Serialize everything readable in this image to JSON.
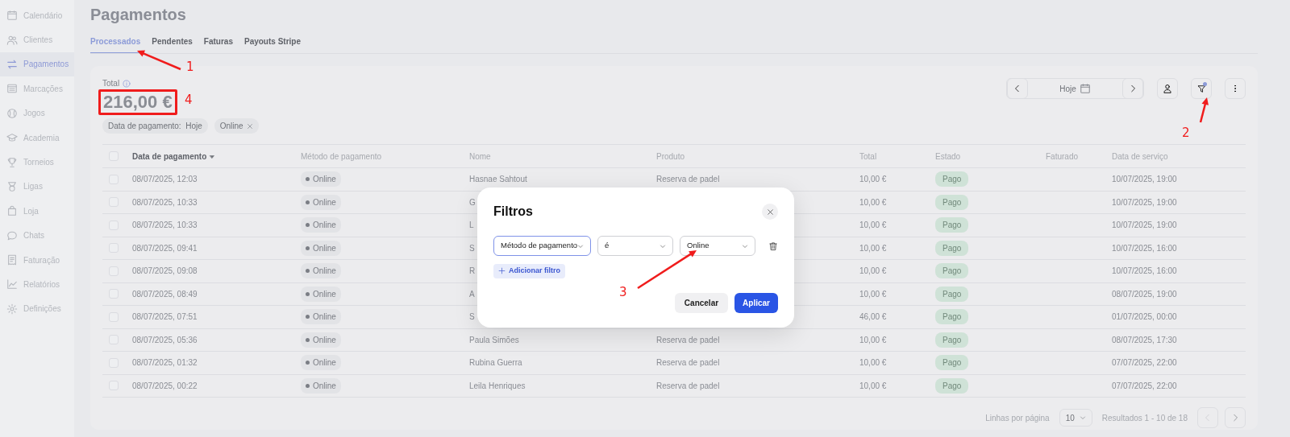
{
  "sidebar": {
    "items": [
      {
        "label": "Calendário",
        "selected": false
      },
      {
        "label": "Clientes",
        "selected": false
      },
      {
        "label": "Pagamentos",
        "selected": true
      },
      {
        "label": "Marcações",
        "selected": false
      },
      {
        "label": "Jogos",
        "selected": false
      },
      {
        "label": "Academia",
        "selected": false
      },
      {
        "label": "Torneios",
        "selected": false
      },
      {
        "label": "Ligas",
        "selected": false
      },
      {
        "label": "Loja",
        "selected": false
      },
      {
        "label": "Chats",
        "selected": false
      },
      {
        "label": "Faturação",
        "selected": false
      },
      {
        "label": "Relatórios",
        "selected": false
      },
      {
        "label": "Definições",
        "selected": false
      }
    ]
  },
  "page": {
    "title": "Pagamentos"
  },
  "tabs": [
    {
      "label": "Processados",
      "selected": true
    },
    {
      "label": "Pendentes",
      "selected": false
    },
    {
      "label": "Faturas",
      "selected": false
    },
    {
      "label": "Payouts Stripe",
      "selected": false
    }
  ],
  "summary": {
    "label": "Total",
    "amount": "216,00 €"
  },
  "toolbar": {
    "date_label": "Hoje",
    "filter_active": true
  },
  "filter_chips": [
    {
      "label": "Data de pagamento:  Hoje",
      "removable": false
    },
    {
      "label": "Online",
      "removable": true
    }
  ],
  "table": {
    "select_all_checked": false,
    "columns": [
      {
        "label": "Data de pagamento",
        "sorted": true
      },
      {
        "label": "Método de pagamento",
        "sorted": false
      },
      {
        "label": "Nome",
        "sorted": false
      },
      {
        "label": "Produto",
        "sorted": false
      },
      {
        "label": "Total",
        "sorted": false
      },
      {
        "label": "Estado",
        "sorted": false
      },
      {
        "label": "Faturado",
        "sorted": false
      },
      {
        "label": "Data de serviço",
        "sorted": false
      }
    ],
    "rows": [
      {
        "checked": false,
        "date": "08/07/2025, 12:03",
        "method": "Online",
        "name": "Hasnae Sahtout",
        "product": "Reserva de padel",
        "total": "10,00 €",
        "status": "Pago",
        "service_date": "10/07/2025, 19:00"
      },
      {
        "checked": false,
        "date": "08/07/2025, 10:33",
        "method": "Online",
        "name": "G",
        "total": "10,00 €",
        "status": "Pago",
        "service_date": "10/07/2025, 19:00"
      },
      {
        "checked": false,
        "date": "08/07/2025, 10:33",
        "method": "Online",
        "name": "L",
        "total": "10,00 €",
        "status": "Pago",
        "service_date": "10/07/2025, 19:00"
      },
      {
        "checked": false,
        "date": "08/07/2025, 09:41",
        "method": "Online",
        "name": "S",
        "total": "10,00 €",
        "status": "Pago",
        "service_date": "10/07/2025, 16:00"
      },
      {
        "checked": false,
        "date": "08/07/2025, 09:08",
        "method": "Online",
        "name": "R",
        "total": "10,00 €",
        "status": "Pago",
        "service_date": "10/07/2025, 16:00"
      },
      {
        "checked": false,
        "date": "08/07/2025, 08:49",
        "method": "Online",
        "name": "A",
        "total": "10,00 €",
        "status": "Pago",
        "service_date": "08/07/2025, 19:00"
      },
      {
        "checked": false,
        "date": "08/07/2025, 07:51",
        "method": "Online",
        "name": "S",
        "total": "46,00 €",
        "status": "Pago",
        "service_date": "01/07/2025, 00:00"
      },
      {
        "checked": false,
        "date": "08/07/2025, 05:36",
        "method": "Online",
        "name": "Paula Simões",
        "product": "Reserva de padel",
        "total": "10,00 €",
        "status": "Pago",
        "service_date": "08/07/2025, 17:30"
      },
      {
        "checked": false,
        "date": "08/07/2025, 01:32",
        "method": "Online",
        "name": "Rubina Guerra",
        "product": "Reserva de padel",
        "total": "10,00 €",
        "status": "Pago",
        "service_date": "07/07/2025, 22:00"
      },
      {
        "checked": false,
        "date": "08/07/2025, 00:22",
        "method": "Online",
        "name": "Leila Henriques",
        "product": "Reserva de padel",
        "total": "10,00 €",
        "status": "Pago",
        "service_date": "07/07/2025, 22:00"
      }
    ]
  },
  "pagination": {
    "rows_label": "Linhas por página",
    "rows_per_page": "10",
    "results": "Resultados 1 - 10 de 18",
    "prev_disabled": true,
    "next_disabled": false
  },
  "dialog": {
    "title": "Filtros",
    "selects": [
      {
        "value": "Método de pagamento",
        "focused": true
      },
      {
        "value": "é",
        "focused": false
      },
      {
        "value": "Online",
        "focused": false
      }
    ],
    "add_filter": "Adicionar filtro",
    "buttons": [
      {
        "label": "Cancelar",
        "kind": "secondary"
      },
      {
        "label": "Aplicar",
        "kind": "primary"
      }
    ]
  },
  "annotations": [
    {
      "label": "1",
      "kind": "arrow"
    },
    {
      "label": "2",
      "kind": "arrow"
    },
    {
      "label": "3",
      "kind": "arrow"
    },
    {
      "label": "4",
      "kind": "box"
    }
  ]
}
